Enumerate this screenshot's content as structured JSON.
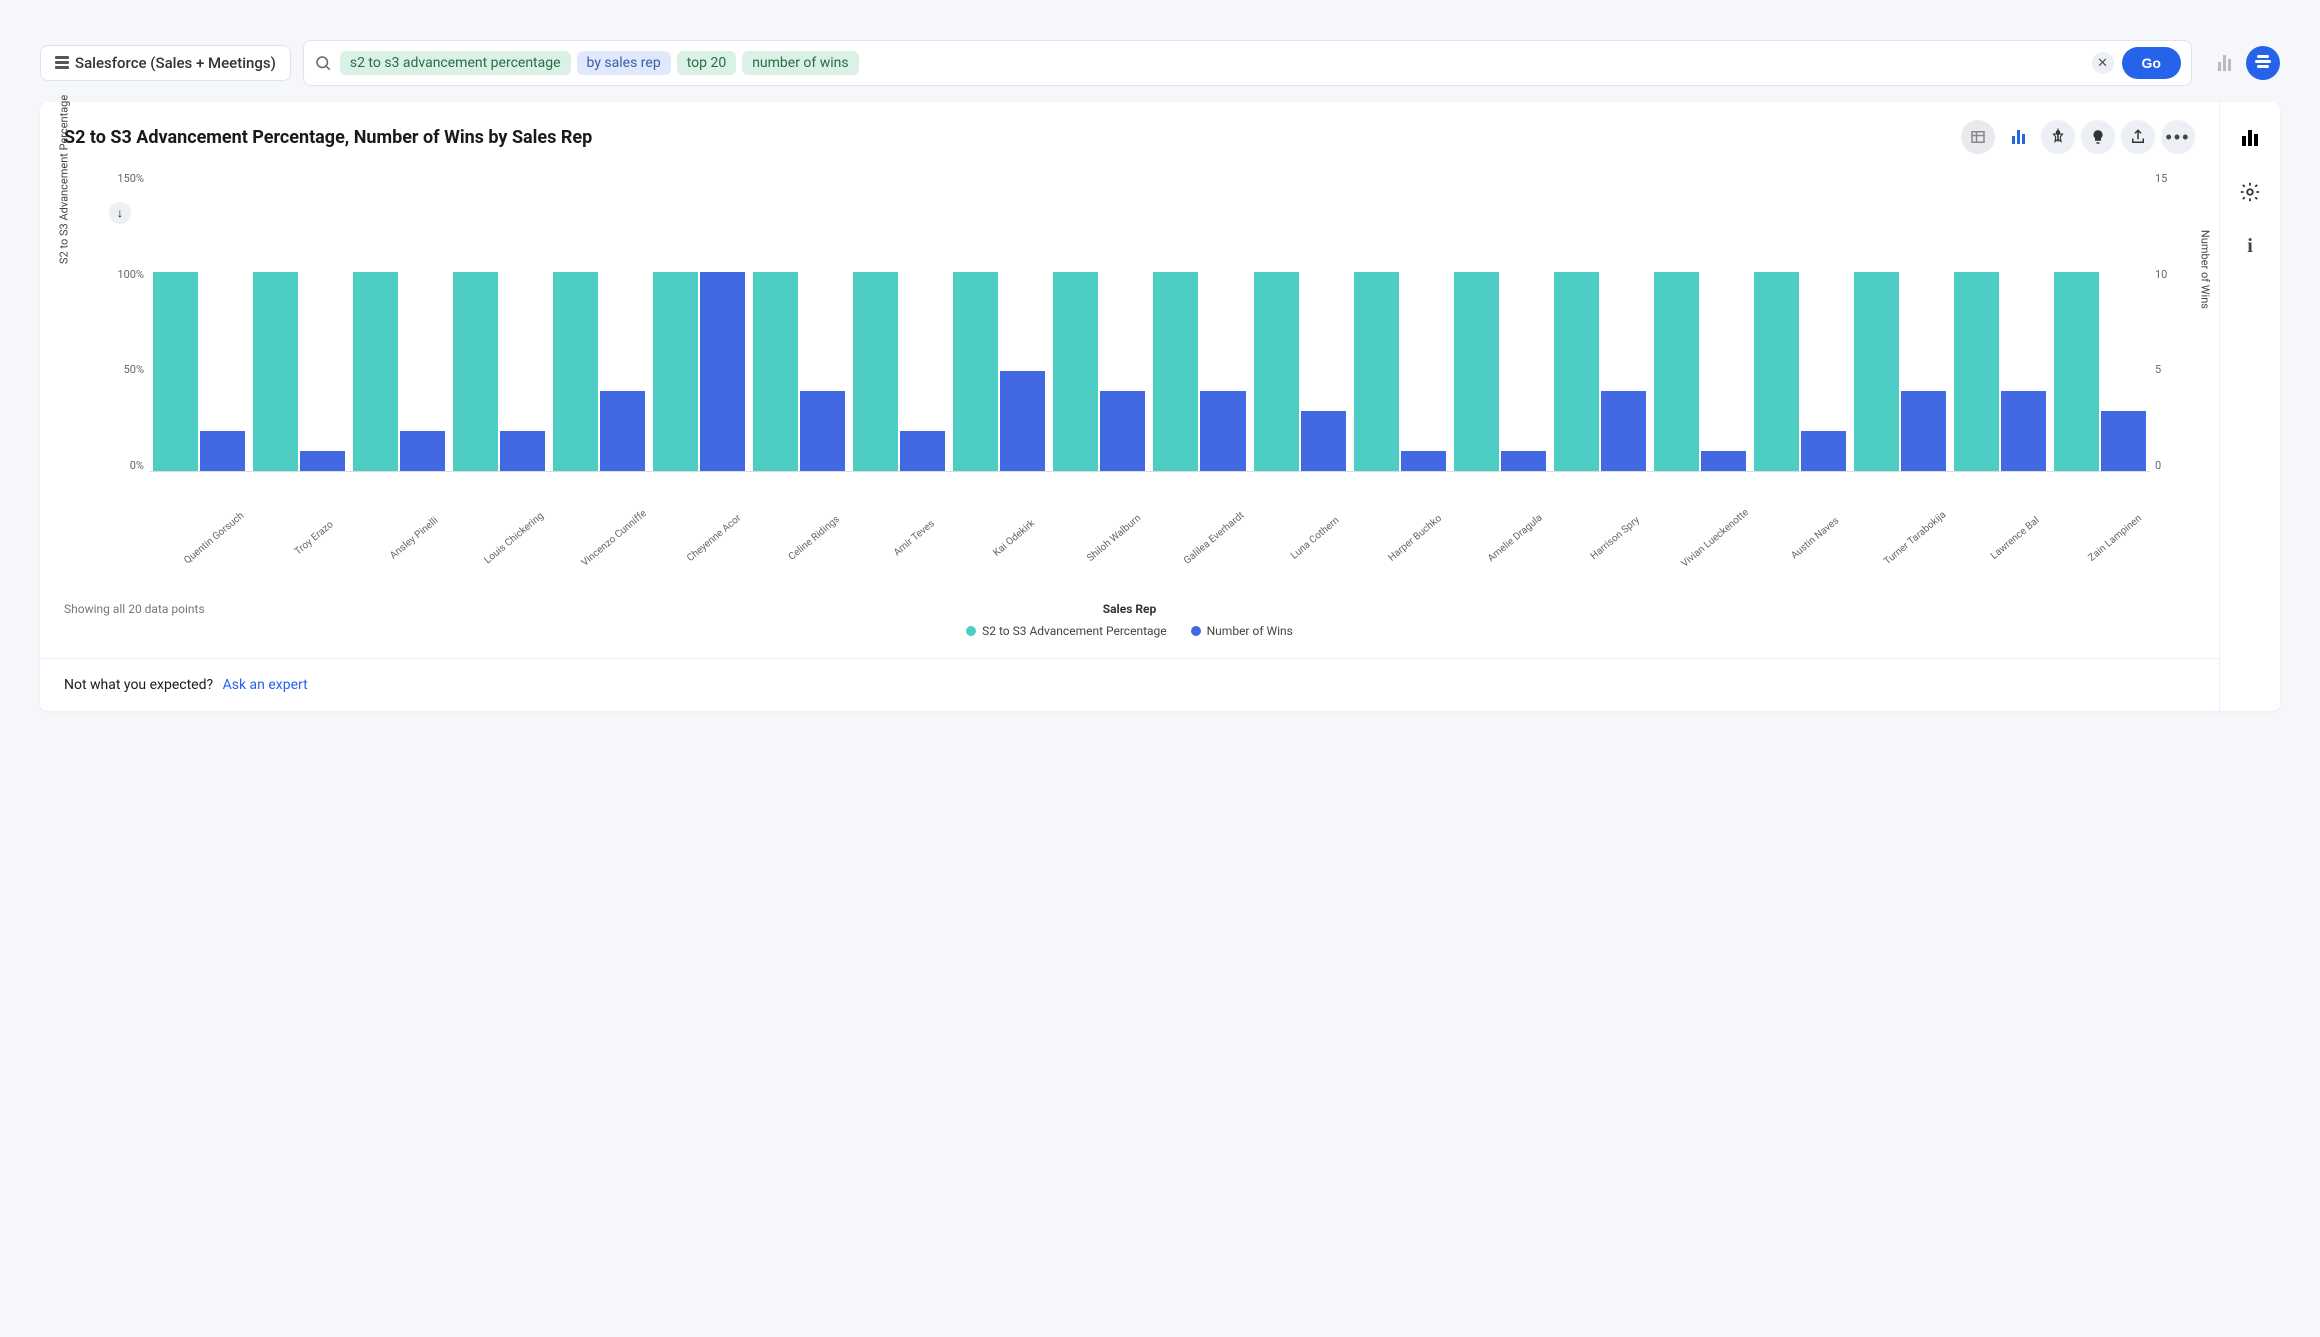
{
  "topbar": {
    "source_label": "Salesforce (Sales + Meetings)",
    "search_pills": [
      {
        "text": "s2 to s3 advancement percentage",
        "style": "green"
      },
      {
        "text": "by sales rep",
        "style": "blue"
      },
      {
        "text": "top 20",
        "style": "green"
      },
      {
        "text": "number of wins",
        "style": "green"
      }
    ],
    "go_label": "Go"
  },
  "card": {
    "title": "S2 to S3 Advancement Percentage, Number of Wins by Sales Rep"
  },
  "chart_data": {
    "type": "bar",
    "categories": [
      "Quentin Gorsuch",
      "Troy Erazo",
      "Ansley Pinelli",
      "Louis Chickering",
      "Vincenzo Cunniffe",
      "Cheyenne Acor",
      "Celine Ridings",
      "Amir Teves",
      "Kai Odekirk",
      "Shiloh Walburn",
      "Galilea Everhardt",
      "Luna Cothern",
      "Harper Buchko",
      "Amelie Dragula",
      "Harrison Spry",
      "Vivian Lueckenotte",
      "Austin Naves",
      "Turner Tarabokija",
      "Lawrence Bal",
      "Zain Lampinen"
    ],
    "series": [
      {
        "name": "S2 to S3 Advancement Percentage",
        "color": "#4ecdc4",
        "axis": "left",
        "values": [
          100,
          100,
          100,
          100,
          100,
          100,
          100,
          100,
          100,
          100,
          100,
          100,
          100,
          100,
          100,
          100,
          100,
          100,
          100,
          100
        ]
      },
      {
        "name": "Number of Wins",
        "color": "#4169e1",
        "axis": "right",
        "values": [
          2,
          1,
          2,
          2,
          4,
          10,
          4,
          2,
          5,
          4,
          4,
          3,
          1,
          1,
          4,
          1,
          2,
          4,
          4,
          3
        ]
      }
    ],
    "y1": {
      "label": "S2 to S3 Advancement Percentage",
      "ticks": [
        "150%",
        "100%",
        "50%",
        "0%"
      ],
      "min": 0,
      "max": 150
    },
    "y2": {
      "label": "Number of Wins",
      "ticks": [
        "15",
        "10",
        "5",
        "0"
      ],
      "min": 0,
      "max": 15
    },
    "xlabel": "Sales Rep",
    "legend": [
      "S2 to S3 Advancement Percentage",
      "Number of Wins"
    ],
    "showing_text": "Showing all 20 data points"
  },
  "footer": {
    "prompt": "Not what you expected?",
    "link": "Ask an expert"
  }
}
